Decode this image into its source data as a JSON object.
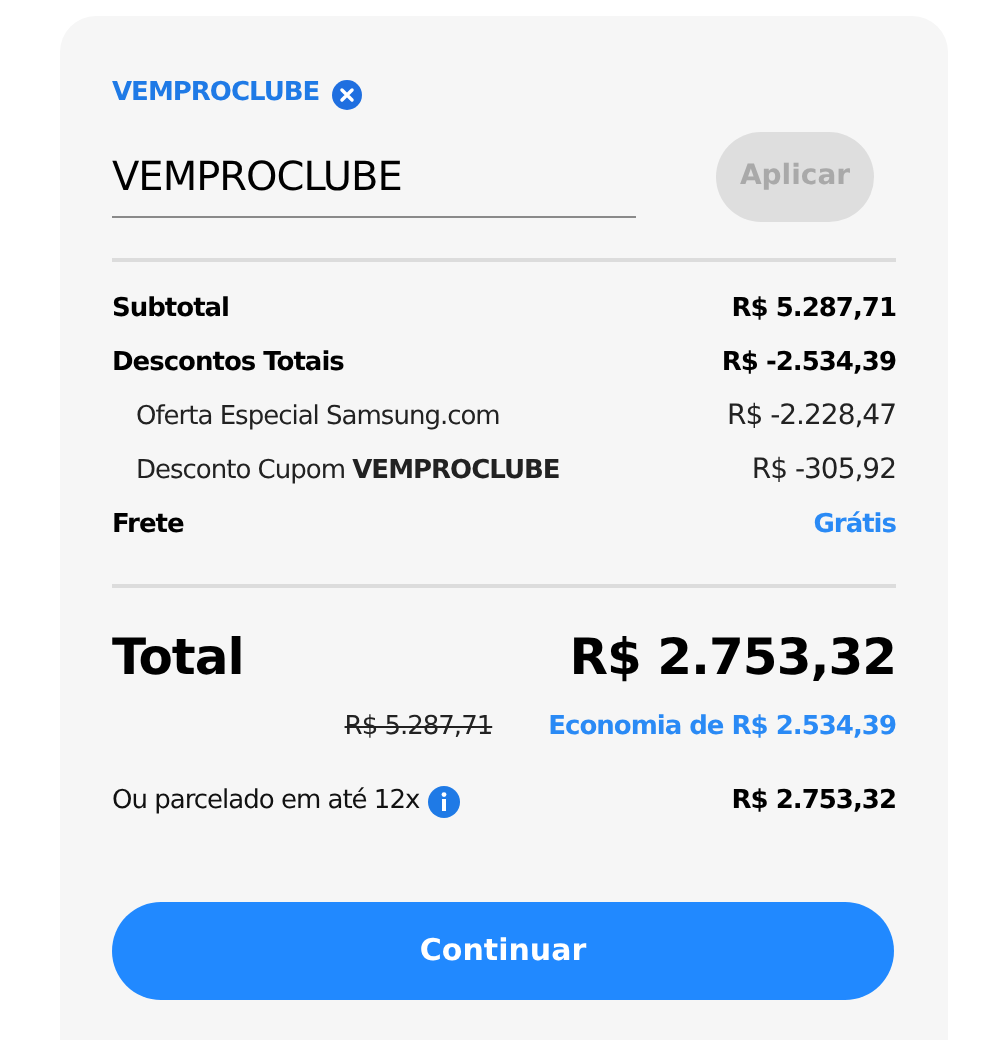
{
  "applied_coupon": {
    "code": "VEMPROCLUBE"
  },
  "coupon_field": {
    "value": "VEMPROCLUBE"
  },
  "apply_button": {
    "label": "Aplicar",
    "disabled": true
  },
  "summary_rows": [
    {
      "kind": "main",
      "label": "Subtotal",
      "value": "R$ 5.287,71"
    },
    {
      "kind": "main",
      "label": "Descontos Totais",
      "value": "R$ -2.534,39"
    },
    {
      "kind": "sub",
      "label": "Oferta Especial Samsung.com",
      "value": "R$ -2.228,47"
    },
    {
      "kind": "sub",
      "label": "Desconto Cupom **VEMPROCLUBE**",
      "value": "R$ -305,92"
    },
    {
      "kind": "highlight",
      "label": "Frete",
      "value": "Grátis"
    }
  ],
  "total": {
    "label": "Total",
    "value": "R$ 2.753,32",
    "old_price": "R$ 5.287,71",
    "savings": "Economia de R$ 2.534,39"
  },
  "installments": {
    "label": "Ou parcelado em até 12x",
    "value": "R$ 2.753,32"
  },
  "continue_button": {
    "label": "Continuar"
  }
}
